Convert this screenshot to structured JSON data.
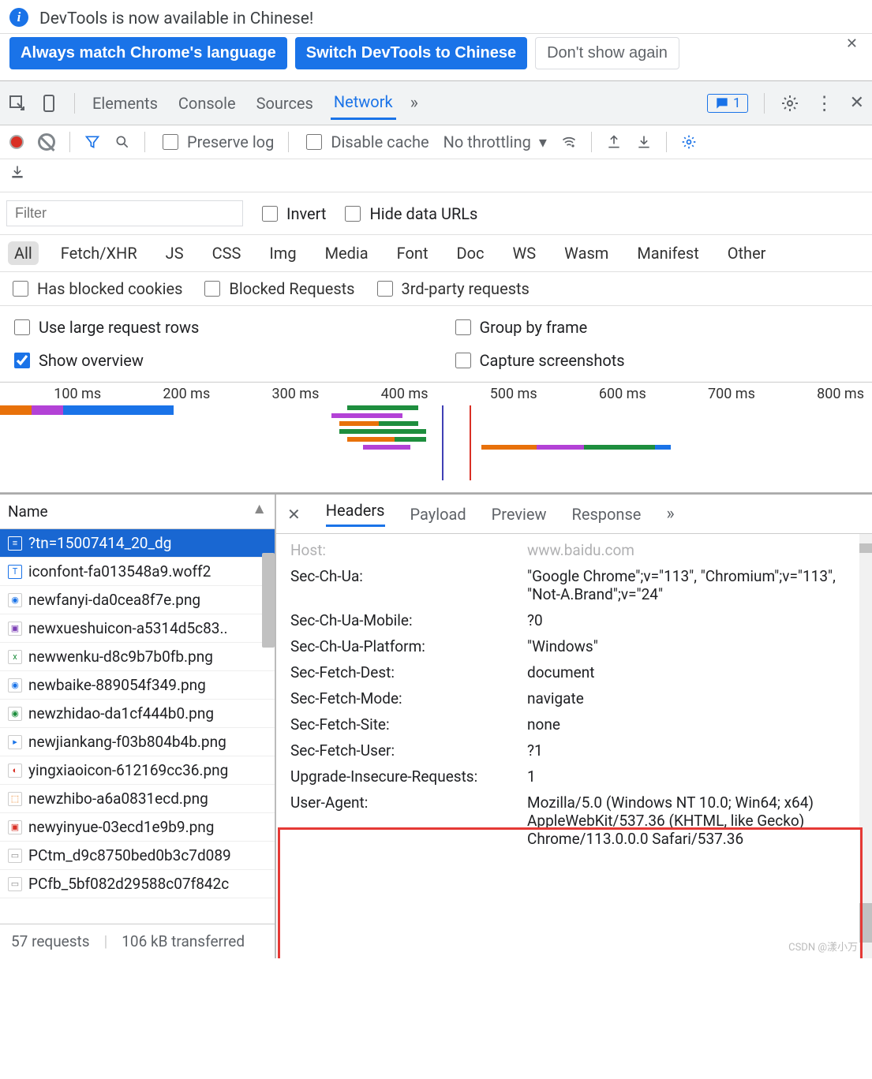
{
  "infobar": {
    "message": "DevTools is now available in Chinese!",
    "btn_match": "Always match Chrome's language",
    "btn_switch": "Switch DevTools to Chinese",
    "btn_dismiss": "Don't show again"
  },
  "main_tabs": {
    "elements": "Elements",
    "console": "Console",
    "sources": "Sources",
    "network": "Network",
    "badge_count": "1"
  },
  "net": {
    "preserve_log": "Preserve log",
    "disable_cache": "Disable cache",
    "throttling": "No throttling"
  },
  "filter": {
    "placeholder": "Filter",
    "invert": "Invert",
    "hide_data_urls": "Hide data URLs",
    "types": {
      "all": "All",
      "fetch": "Fetch/XHR",
      "js": "JS",
      "css": "CSS",
      "img": "Img",
      "media": "Media",
      "font": "Font",
      "doc": "Doc",
      "ws": "WS",
      "wasm": "Wasm",
      "manifest": "Manifest",
      "other": "Other"
    },
    "has_blocked": "Has blocked cookies",
    "blocked_req": "Blocked Requests",
    "third_party": "3rd-party requests",
    "use_large": "Use large request rows",
    "group_frame": "Group by frame",
    "show_overview": "Show overview",
    "capture_ss": "Capture screenshots"
  },
  "timeline": {
    "ticks": [
      "100 ms",
      "200 ms",
      "300 ms",
      "400 ms",
      "500 ms",
      "600 ms",
      "700 ms",
      "800 ms"
    ]
  },
  "requests": {
    "name_header": "Name",
    "items": [
      "?tn=15007414_20_dg",
      "iconfont-fa013548a9.woff2",
      "newfanyi-da0cea8f7e.png",
      "newxueshuicon-a5314d5c83..",
      "newwenku-d8c9b7b0fb.png",
      "newbaike-889054f349.png",
      "newzhidao-da1cf444b0.png",
      "newjiankang-f03b804b4b.png",
      "yingxiaoicon-612169cc36.png",
      "newzhibo-a6a0831ecd.png",
      "newyinyue-03ecd1e9b9.png",
      "PCtm_d9c8750bed0b3c7d089",
      "PCfb_5bf082d29588c07f842c"
    ],
    "status": {
      "count": "57 requests",
      "transferred": "106 kB transferred"
    }
  },
  "detail": {
    "tabs": {
      "headers": "Headers",
      "payload": "Payload",
      "preview": "Preview",
      "response": "Response"
    },
    "rows": {
      "host_key": "Host:",
      "host_val": "www.baidu.com",
      "secchua_key": "Sec-Ch-Ua:",
      "secchua_val": "\"Google Chrome\";v=\"113\", \"Chromium\";v=\"113\", \"Not-A.Brand\";v=\"24\"",
      "secchua_mobile_key": "Sec-Ch-Ua-Mobile:",
      "secchua_mobile_val": "?0",
      "secchua_platform_key": "Sec-Ch-Ua-Platform:",
      "secchua_platform_val": "\"Windows\"",
      "fetch_dest_key": "Sec-Fetch-Dest:",
      "fetch_dest_val": "document",
      "fetch_mode_key": "Sec-Fetch-Mode:",
      "fetch_mode_val": "navigate",
      "fetch_site_key": "Sec-Fetch-Site:",
      "fetch_site_val": "none",
      "fetch_user_key": "Sec-Fetch-User:",
      "fetch_user_val": "?1",
      "upgrade_key": "Upgrade-Insecure-Requests:",
      "upgrade_val": "1",
      "ua_key": "User-Agent:",
      "ua_val": "Mozilla/5.0 (Windows NT 10.0; Win64; x64) AppleWebKit/537.36 (KHTML, like Gecko) Chrome/113.0.0.0 Safari/537.36"
    }
  },
  "watermark": "CSDN @漾小万"
}
